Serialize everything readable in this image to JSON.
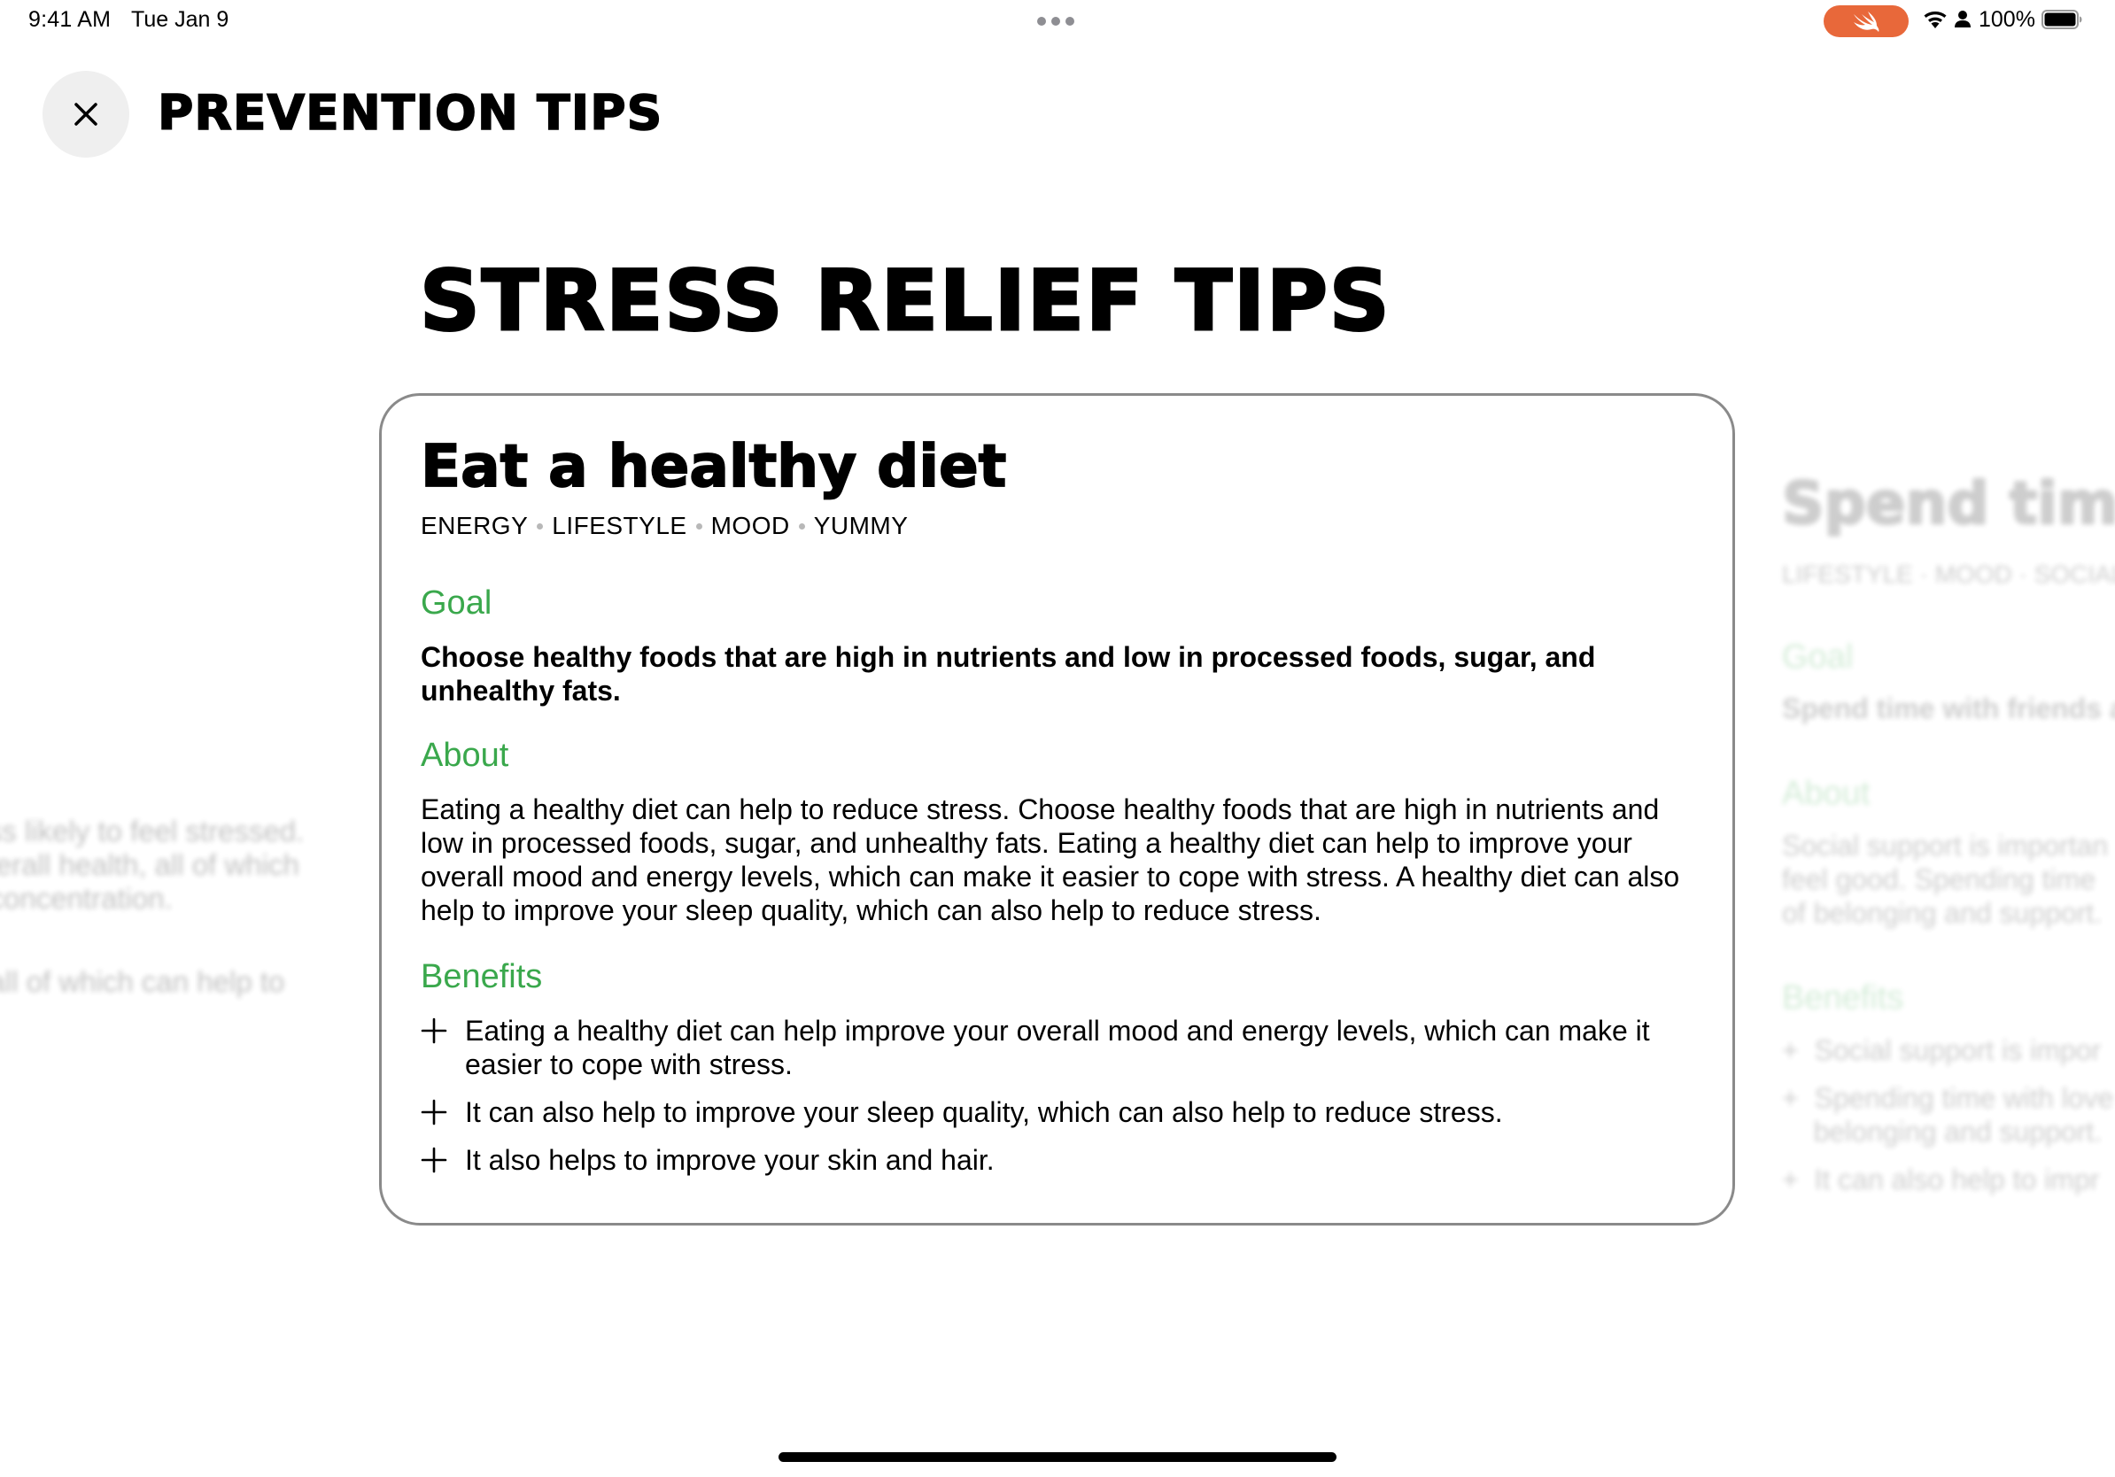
{
  "status_bar": {
    "time": "9:41 AM",
    "date": "Tue Jan 9",
    "battery": "100%",
    "icons": [
      "swift-icon",
      "wifi-icon",
      "person-icon",
      "battery-icon"
    ],
    "swift_color": "#e8683a"
  },
  "header": {
    "title": "PREVENTION TIPS",
    "close_icon": "close-icon"
  },
  "page": {
    "title": "STRESS RELIEF TIPS"
  },
  "card": {
    "title": "Eat a healthy diet",
    "tags": [
      "ENERGY",
      "LIFESTYLE",
      "MOOD",
      "YUMMY"
    ],
    "goal_heading": "Goal",
    "goal": "Choose healthy foods that are high in nutrients and low in processed foods, sugar, and unhealthy fats.",
    "about_heading": "About",
    "about": "Eating a healthy diet can help to reduce stress. Choose healthy foods that are high in nutrients and low in processed foods, sugar, and unhealthy fats. Eating a healthy diet can help to improve your overall mood and energy levels, which can make it easier to cope with stress. A healthy diet can also help to improve your sleep quality, which can also help to reduce stress.",
    "benefits_heading": "Benefits",
    "benefits": [
      "Eating a healthy diet can help improve your overall mood and energy levels, which can make it easier to cope with stress.",
      "It can also help to improve your sleep quality, which can also help to reduce stress.",
      "It also helps to improve your skin and hair."
    ],
    "accent_color": "#3aa84c"
  },
  "left_card_peek": {
    "lines": [
      "less likely to feel stressed.",
      "overall health, all of which",
      "d concentration.",
      "d all of which can help to"
    ]
  },
  "right_card_peek": {
    "title": "Spend tim",
    "tags": "LIFESTYLE · MOOD · SOCIAL",
    "goal_heading": "Goal",
    "goal": "Spend time with friends a",
    "about_heading": "About",
    "about_lines": [
      "Social support is importan",
      "feel good. Spending time",
      "of belonging and support."
    ],
    "benefits_heading": "Benefits",
    "benefits": [
      "Social support is impor",
      "Spending time with love",
      "belonging and support.",
      "It can also help to impr"
    ]
  }
}
